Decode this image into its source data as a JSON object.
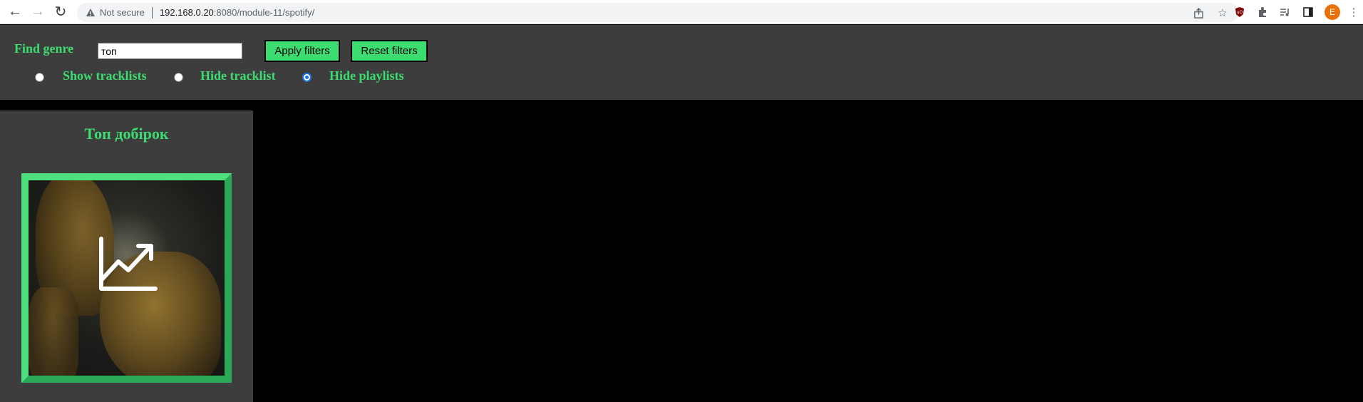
{
  "browser": {
    "security_label": "Not secure",
    "url_host": "192.168.0.20",
    "url_path": ":8080/module-11/spotify/",
    "avatar_letter": "E"
  },
  "filters": {
    "find_genre_label": "Find genre",
    "genre_input_value": "топ",
    "apply_button": "Apply filters",
    "reset_button": "Reset filters",
    "radio_options": [
      {
        "label": "Show tracklists",
        "checked": false
      },
      {
        "label": "Hide tracklist",
        "checked": false
      },
      {
        "label": "Hide playlists",
        "checked": true
      }
    ]
  },
  "playlists": [
    {
      "title": "Топ добірок",
      "icon": "trending-up-icon"
    }
  ],
  "colors": {
    "accent": "#3ddc70",
    "panel": "#3d3d3d",
    "background": "#000000"
  }
}
